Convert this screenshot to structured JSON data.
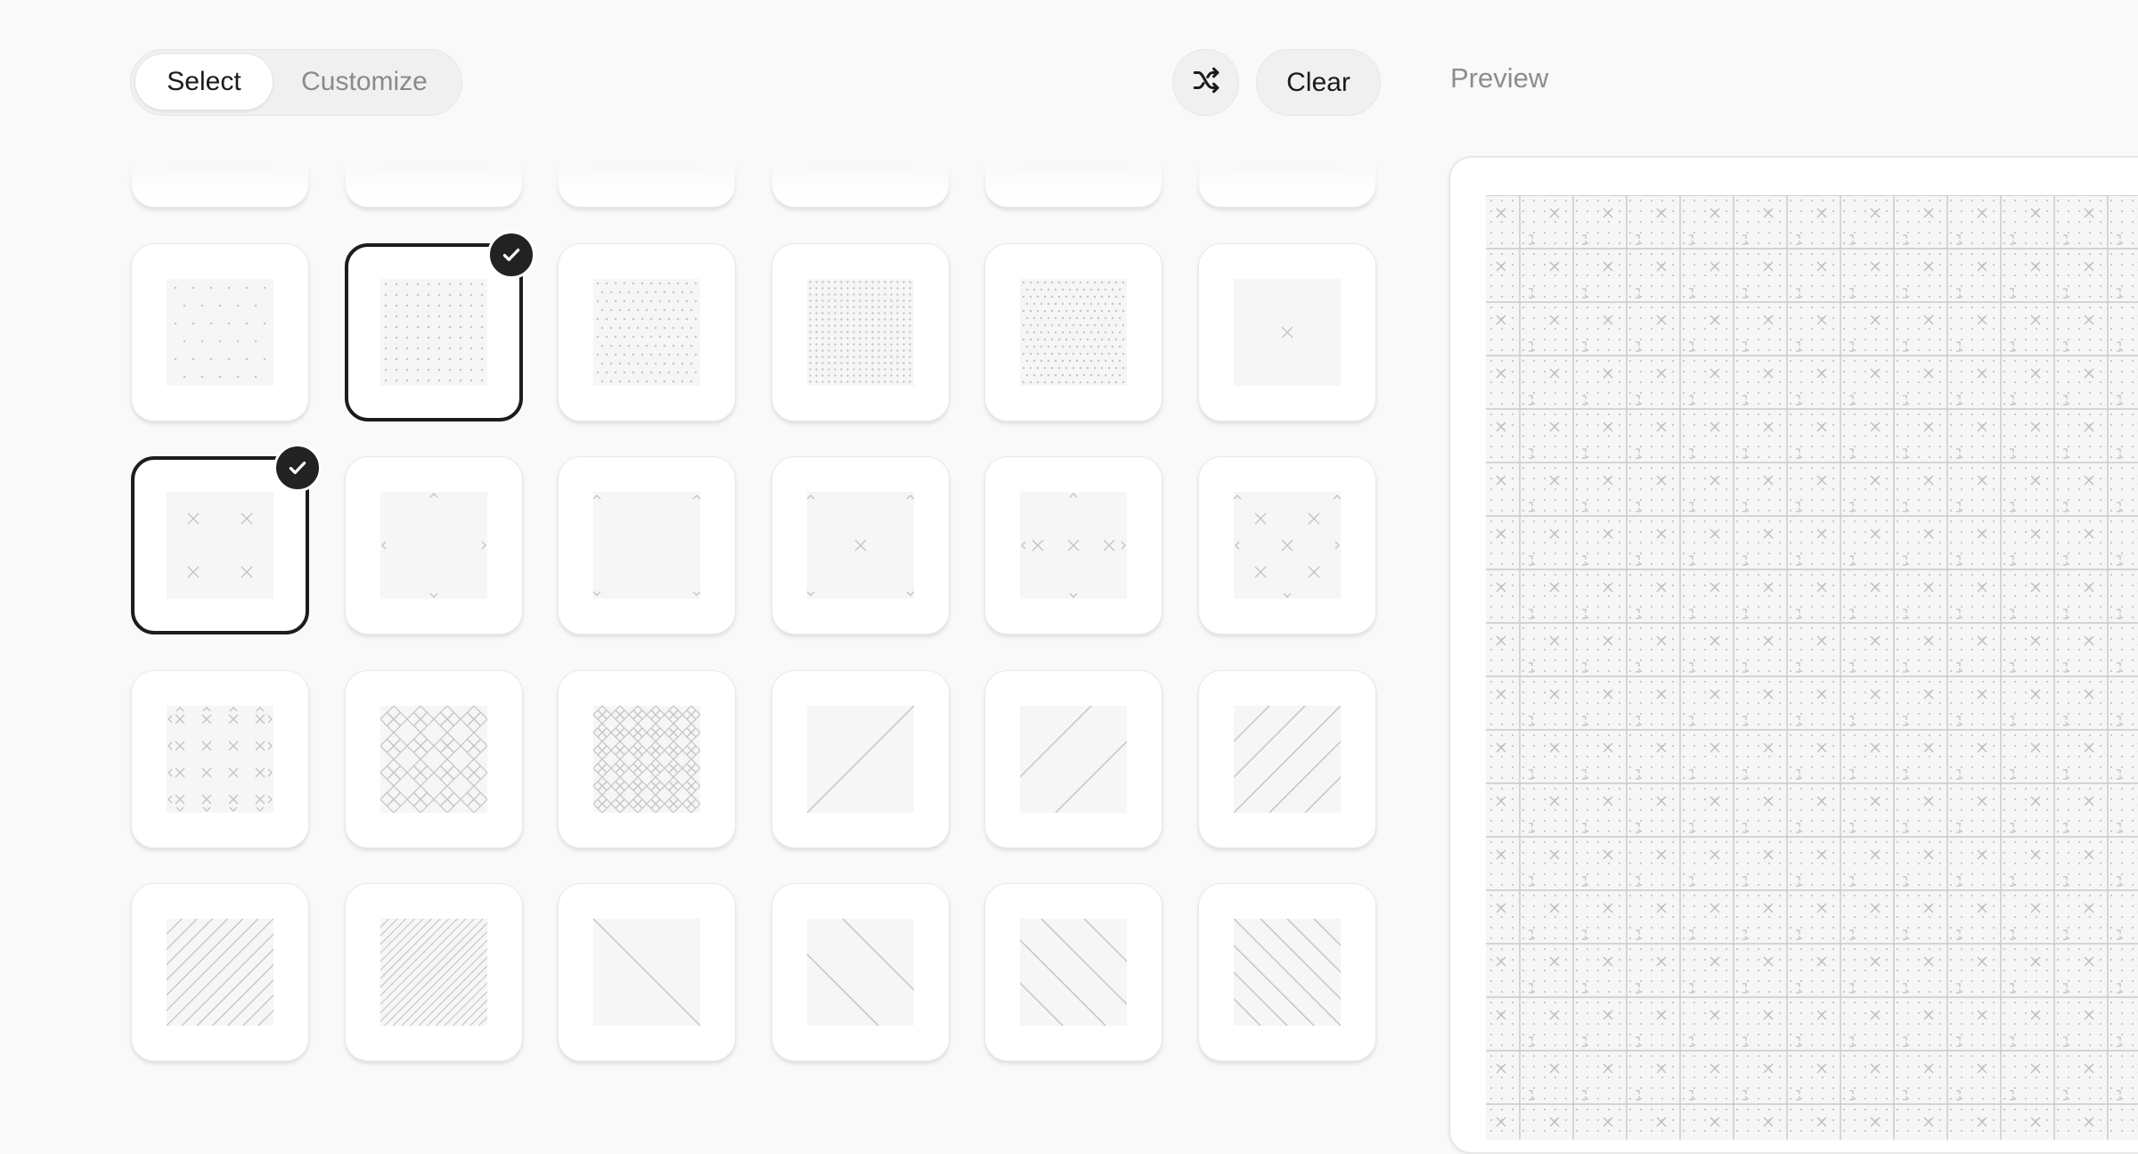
{
  "toolbar": {
    "tabs": [
      {
        "label": "Select",
        "active": true
      },
      {
        "label": "Customize",
        "active": false
      }
    ],
    "shuffle_icon": "shuffle-icon",
    "clear_label": "Clear",
    "preview_label": "Preview"
  },
  "patterns": {
    "columns": 6,
    "items": [
      {
        "pattern": "dots-sparse",
        "selected": false
      },
      {
        "pattern": "dots-sparse",
        "selected": false
      },
      {
        "pattern": "dots-sparse",
        "selected": false
      },
      {
        "pattern": "dots-sparse",
        "selected": false
      },
      {
        "pattern": "dots-sparse",
        "selected": false
      },
      {
        "pattern": "dots-sparse",
        "selected": false
      },
      {
        "pattern": "dots-offset",
        "selected": false
      },
      {
        "pattern": "dots-grid",
        "selected": true
      },
      {
        "pattern": "dots-medium",
        "selected": false
      },
      {
        "pattern": "dots-dense",
        "selected": false
      },
      {
        "pattern": "dots-diagonal-dense",
        "selected": false
      },
      {
        "pattern": "cross-single",
        "selected": false
      },
      {
        "pattern": "cross-four",
        "selected": true
      },
      {
        "pattern": "chevrons-edge",
        "selected": false
      },
      {
        "pattern": "corner-marks",
        "selected": false
      },
      {
        "pattern": "cross-corners",
        "selected": false
      },
      {
        "pattern": "cross-chevrons",
        "selected": false
      },
      {
        "pattern": "cross-chevrons-dense",
        "selected": false
      },
      {
        "pattern": "cross-grid",
        "selected": false
      },
      {
        "pattern": "cross-lattice",
        "selected": false
      },
      {
        "pattern": "cross-lattice-dense",
        "selected": false
      },
      {
        "pattern": "diagonal-single",
        "selected": false
      },
      {
        "pattern": "diagonal-two",
        "selected": false
      },
      {
        "pattern": "diagonal-many",
        "selected": false
      },
      {
        "pattern": "diagonal-fine",
        "selected": false
      },
      {
        "pattern": "diagonal-finest",
        "selected": false
      },
      {
        "pattern": "anti-diagonal-single",
        "selected": false
      },
      {
        "pattern": "anti-diagonal-two",
        "selected": false
      },
      {
        "pattern": "anti-diagonal-few",
        "selected": false
      },
      {
        "pattern": "anti-diagonal-many",
        "selected": false
      }
    ]
  },
  "colors": {
    "background": "#f9f9f9",
    "card": "#ffffff",
    "thumb": "#f6f6f6",
    "pattern_stroke": "#c4c4c4",
    "selected_border": "#1c1c1c"
  }
}
